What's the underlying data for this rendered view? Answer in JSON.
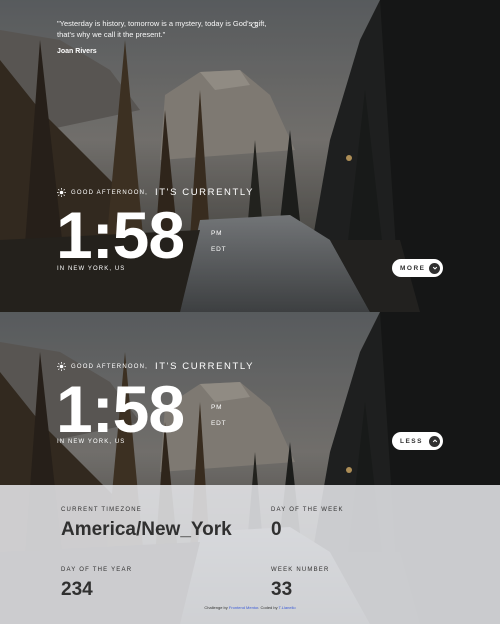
{
  "quote": {
    "text": "\"Yesterday is history, tomorrow is a mystery, today is God's gift, that's why we call it the present.\"",
    "author": "Joan Rivers"
  },
  "clock": {
    "greeting": "GOOD AFTERNOON,",
    "currently": "IT'S CURRENTLY",
    "time": "1:58",
    "meridiem": "PM",
    "zone": "EDT",
    "location": "IN NEW YORK, US"
  },
  "buttons": {
    "more": "MORE",
    "less": "LESS"
  },
  "details": {
    "timezone_label": "CURRENT TIMEZONE",
    "timezone_value": "America/New_York",
    "day_of_week_label": "DAY OF THE WEEK",
    "day_of_week_value": "0",
    "day_of_year_label": "DAY OF THE YEAR",
    "day_of_year_value": "234",
    "week_number_label": "WEEK NUMBER",
    "week_number_value": "33"
  },
  "footer": {
    "prefix": "Challenge by",
    "challenge_link": "Frontend Mentor",
    "middle": ". Coded by",
    "author_link": "T.Llanello"
  }
}
